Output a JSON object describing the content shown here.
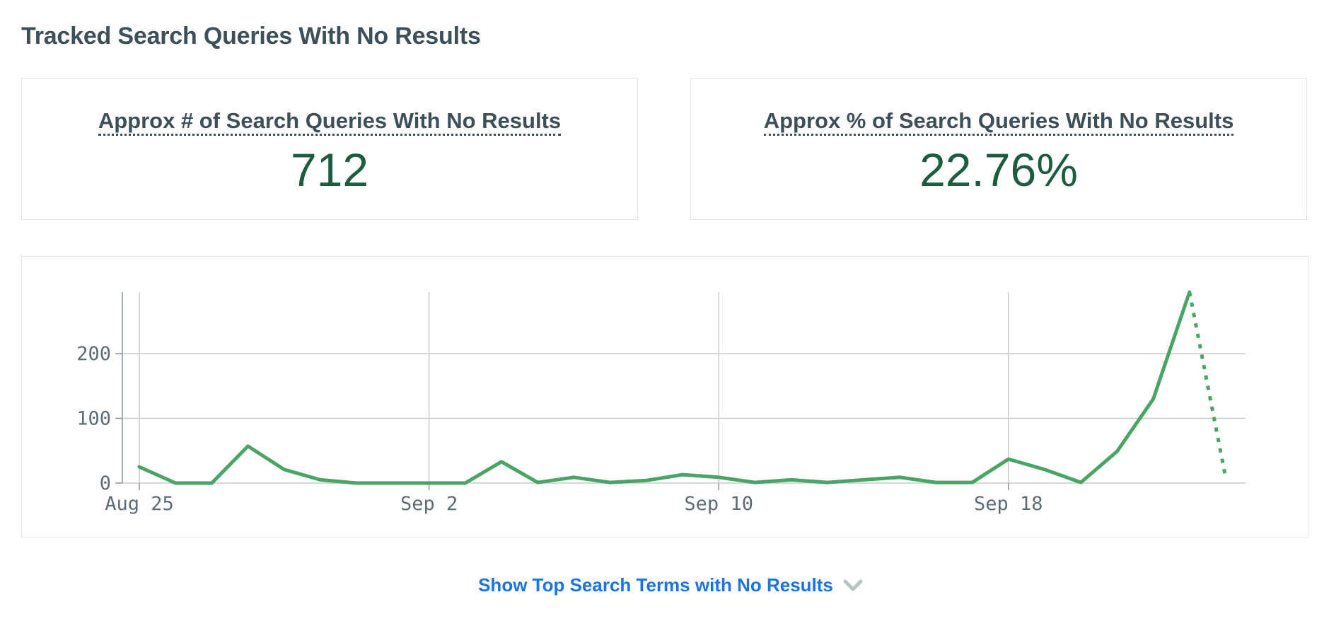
{
  "page_title": "Tracked Search Queries With No Results",
  "stats": {
    "count_label": "Approx # of Search Queries With No Results",
    "count_value": "712",
    "percent_label": "Approx % of Search Queries With No Results",
    "percent_value": "22.76%"
  },
  "show_more_label": "Show Top Search Terms with No Results",
  "colors": {
    "line": "#4aa564",
    "value_text": "#1e5c40",
    "link": "#1a73e8"
  },
  "chart_data": {
    "type": "line",
    "x_tick_labels": [
      "Aug 25",
      "Sep 2",
      "Sep 10",
      "Sep 18"
    ],
    "y_tick_labels": [
      "0",
      "100",
      "200"
    ],
    "ylim": [
      0,
      295
    ],
    "grid": true,
    "series": [
      {
        "x": [
          "Aug 25",
          "Aug 26",
          "Aug 27",
          "Aug 28",
          "Aug 29",
          "Aug 30",
          "Aug 31",
          "Sep 1",
          "Sep 2",
          "Sep 3",
          "Sep 4",
          "Sep 5",
          "Sep 6",
          "Sep 7",
          "Sep 8",
          "Sep 9",
          "Sep 10",
          "Sep 11",
          "Sep 12",
          "Sep 13",
          "Sep 14",
          "Sep 15",
          "Sep 16",
          "Sep 17",
          "Sep 18",
          "Sep 19",
          "Sep 20",
          "Sep 21",
          "Sep 22",
          "Sep 23"
        ],
        "values": [
          25,
          0,
          0,
          57,
          21,
          5,
          0,
          0,
          0,
          0,
          33,
          1,
          9,
          1,
          4,
          13,
          9,
          1,
          5,
          1,
          5,
          9,
          1,
          1,
          37,
          21,
          1,
          49,
          130,
          295
        ],
        "style": "solid"
      },
      {
        "x": [
          "Sep 23",
          "Sep 24"
        ],
        "values": [
          295,
          8
        ],
        "style": "dotted"
      }
    ]
  }
}
